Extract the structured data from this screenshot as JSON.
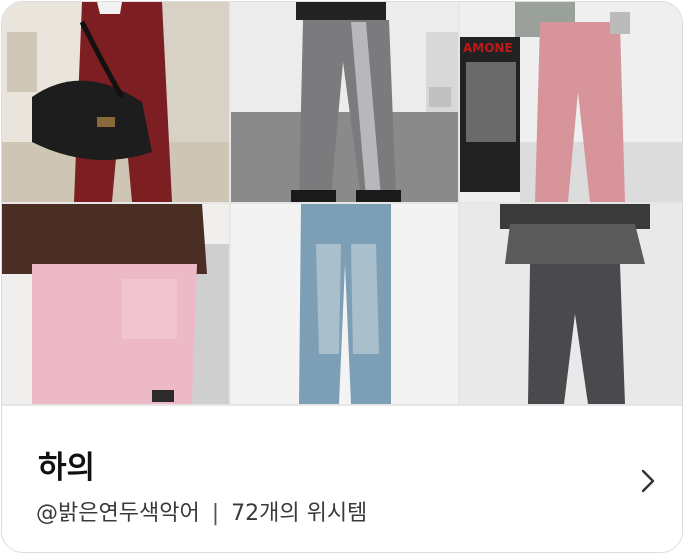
{
  "collection": {
    "title": "하의",
    "owner": "@밝은연두색악어",
    "separator": "|",
    "item_count": "72개의 위시템"
  },
  "thumbnails": [
    {
      "alt": "burgundy cargo pants with black bag"
    },
    {
      "alt": "grey side-stripe track pants"
    },
    {
      "alt": "pink corduroy cargo pants"
    },
    {
      "alt": "pink carpenter pants"
    },
    {
      "alt": "washed wide denim jeans"
    },
    {
      "alt": "charcoal flared pants with skirt layer"
    }
  ],
  "icons": {
    "next": "chevron-right-icon"
  }
}
